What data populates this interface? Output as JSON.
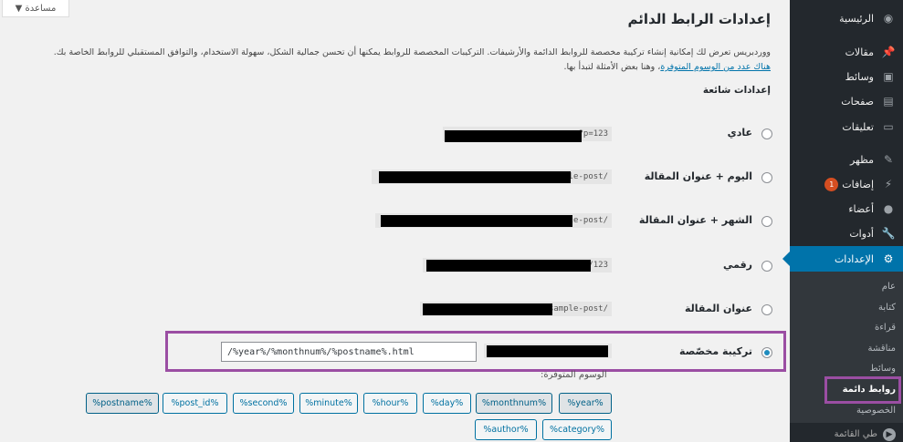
{
  "help_tab": {
    "label": "مساعدة ▼"
  },
  "sidebar": {
    "items": [
      {
        "label": "الرئيسية",
        "icon": "dashboard-icon"
      },
      {
        "label": "مقالات",
        "icon": "pin-icon"
      },
      {
        "label": "وسائط",
        "icon": "media-icon"
      },
      {
        "label": "صفحات",
        "icon": "page-icon"
      },
      {
        "label": "تعليقات",
        "icon": "comment-icon"
      },
      {
        "label": "مظهر",
        "icon": "brush-icon"
      },
      {
        "label": "إضافات",
        "icon": "plugin-icon",
        "badge": "1"
      },
      {
        "label": "أعضاء",
        "icon": "user-icon"
      },
      {
        "label": "أدوات",
        "icon": "wrench-icon"
      },
      {
        "label": "الإعدادات",
        "icon": "settings-icon"
      }
    ],
    "submenu": [
      "عام",
      "كتابة",
      "قراءة",
      "مناقشة",
      "وسائط",
      "روابط دائمة",
      "الخصوصية"
    ],
    "collapse_label": "طي القائمة"
  },
  "page": {
    "title": "إعدادات الرابط الدائم",
    "intro_line1": "ووردبريس تعرض لك إمكانية إنشاء تركيبة مخصصة للروابط الدائمة والأرشيفات. التركيبات المخصصة للروابط يمكنها أن تحسن جمالية الشكل، سهولة الاستخدام، والتوافق المستقبلي للروابط الخاصة بك.",
    "intro_link": "هناك عدد من الوسوم المتوفرة",
    "intro_line2": "، وهنا بعض الأمثلة لتبدأ بها.",
    "section_title": "إعدادات شائعة"
  },
  "options": [
    {
      "label": "عادي",
      "example": "?p=123",
      "checked": false
    },
    {
      "label": "اليوم + عنوان المقالة",
      "example": "/sample-post/",
      "checked": false
    },
    {
      "label": "الشهر + عنوان المقالة",
      "example": "/sample-post/",
      "checked": false
    },
    {
      "label": "رقمي",
      "example": "/123",
      "checked": false
    },
    {
      "label": "عنوان المقالة",
      "example": "/sample-post/",
      "checked": false
    },
    {
      "label": "تركيبة مخصّصة",
      "example": "",
      "checked": true
    }
  ],
  "custom_structure": {
    "value": "/%year%/%monthnum%/%postname%.html"
  },
  "tags_label": "الوسوم المتوفرة:",
  "tags": [
    "%year%",
    "%monthnum%",
    "%day%",
    "%hour%",
    "%minute%",
    "%second%",
    "%post_id%",
    "%postname%",
    "%category%",
    "%author%"
  ],
  "colors": {
    "accent": "#0073aa",
    "highlight": "#9b4ea3",
    "sidebar": "#23282d"
  }
}
